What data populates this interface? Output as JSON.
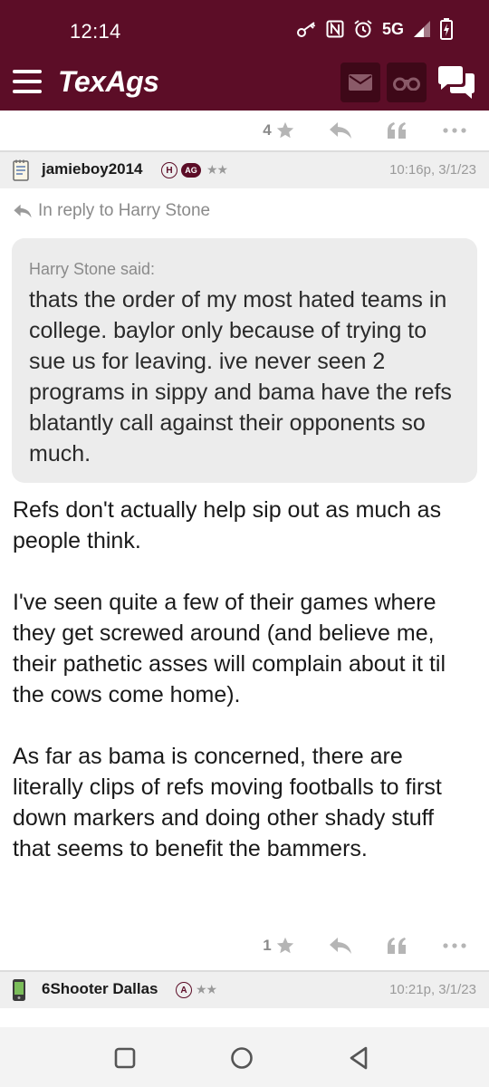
{
  "status": {
    "time": "12:14",
    "network": "5G"
  },
  "header": {
    "brand": "TexAgs"
  },
  "prev_post": {
    "likes": "4"
  },
  "post": {
    "author": "jamieboy2014",
    "badge_h": "H",
    "badge_ag": "AG",
    "stars": "★★",
    "time": "10:16p, 3/1/23",
    "reply_to": "In reply to Harry Stone",
    "quote": {
      "author": "Harry Stone said:",
      "text": "thats the order of my most hated teams in college. baylor only because of trying to sue us for leaving. ive never seen 2 programs in sippy and bama have the refs blatantly call against their opponents so much."
    },
    "body": [
      "Refs don't actually help sip out as much as people think.",
      "I've seen quite a few of their games where they get screwed around (and believe me, their pathetic asses will complain about it til the cows come home).",
      "As far as bama is concerned, there are literally clips of refs moving footballs to first down markers and doing other shady stuff that seems to benefit the bammers."
    ],
    "likes": "1"
  },
  "next_post": {
    "author": "6Shooter Dallas",
    "badge": "A",
    "stars": "★★",
    "time": "10:21p, 3/1/23"
  },
  "colors": {
    "maroon": "#5c0d27",
    "header_dark": "#3e0818",
    "grey_text": "#8a8a8a"
  },
  "icons": {
    "status": [
      "key-icon",
      "nfc-icon",
      "alarm-icon",
      "signal-icon",
      "battery-icon"
    ],
    "header": [
      "menu-icon",
      "mail-icon",
      "binoculars-icon",
      "chat-icon"
    ],
    "actions": [
      "star-icon",
      "reply-icon",
      "quote-icon",
      "more-icon"
    ],
    "nav": [
      "recents-icon",
      "home-icon",
      "back-icon"
    ]
  }
}
